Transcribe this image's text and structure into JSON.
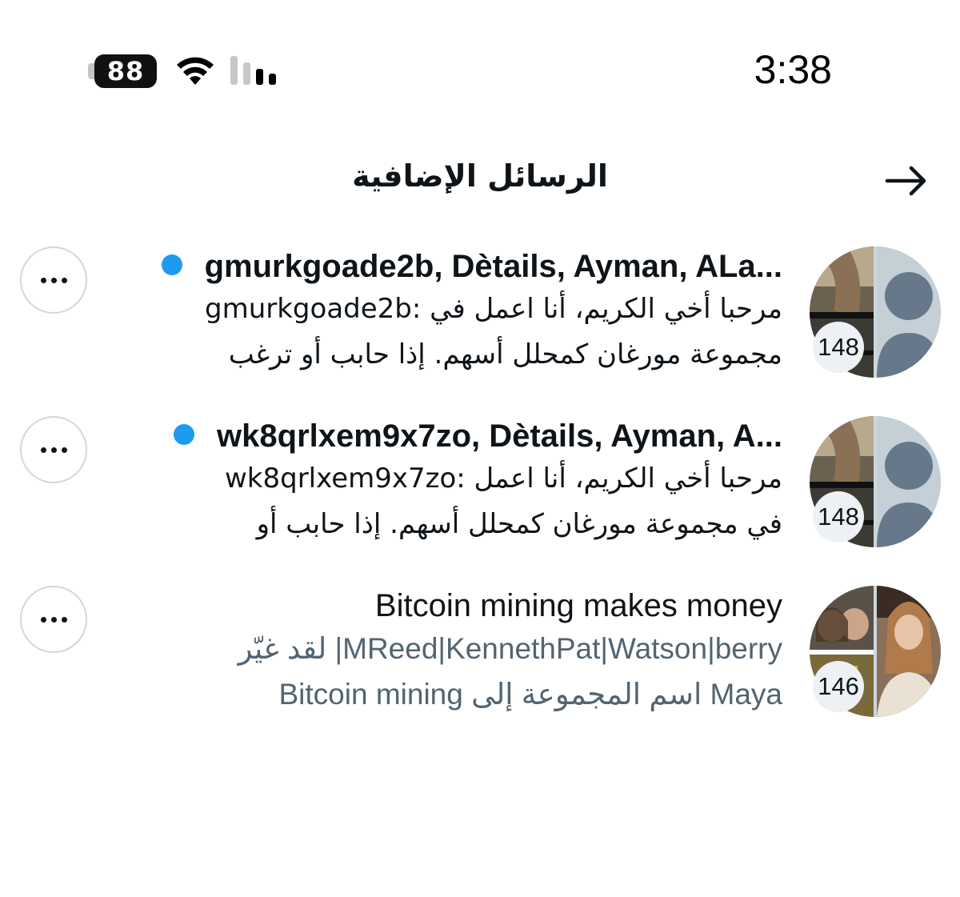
{
  "status_bar": {
    "battery": "88",
    "time": "3:38",
    "icons": [
      "battery-icon",
      "wifi-icon",
      "cellular-signal-icon"
    ]
  },
  "header": {
    "title": "الرسائل الإضافية",
    "back_icon": "arrow-right-icon"
  },
  "conversations": [
    {
      "title": "gmurkgoade2b, Dètails, Ayman, ALa...",
      "unread": true,
      "preview_line1": "مرحبا أخي الكريم، أنا اعمل في :gmurkgoade2b",
      "preview_line2": "مجموعة مورغان كمحلل أسهم. إذا حابب أو ترغب",
      "member_count": "148",
      "more_icon": "more-horizontal-icon"
    },
    {
      "title": "wk8qrlxem9x7zo, Dètails, Ayman, A...",
      "unread": true,
      "preview_line1": "مرحبا أخي الكريم، أنا اعمل :wk8qrlxem9x7zo",
      "preview_line2": "في مجموعة مورغان كمحلل أسهم. إذا حابب أو",
      "member_count": "148",
      "more_icon": "more-horizontal-icon"
    },
    {
      "title": "Bitcoin mining makes money",
      "unread": false,
      "preview_line1": "MReed|KennethPat|Watson|berry| لقد غيّر",
      "preview_line2": "Maya اسم المجموعة إلى Bitcoin mining",
      "member_count": "146",
      "more_icon": "more-horizontal-icon"
    }
  ],
  "colors": {
    "unread_dot": "#1d9bf0",
    "muted_text": "#536471",
    "border": "#cfd9de"
  }
}
